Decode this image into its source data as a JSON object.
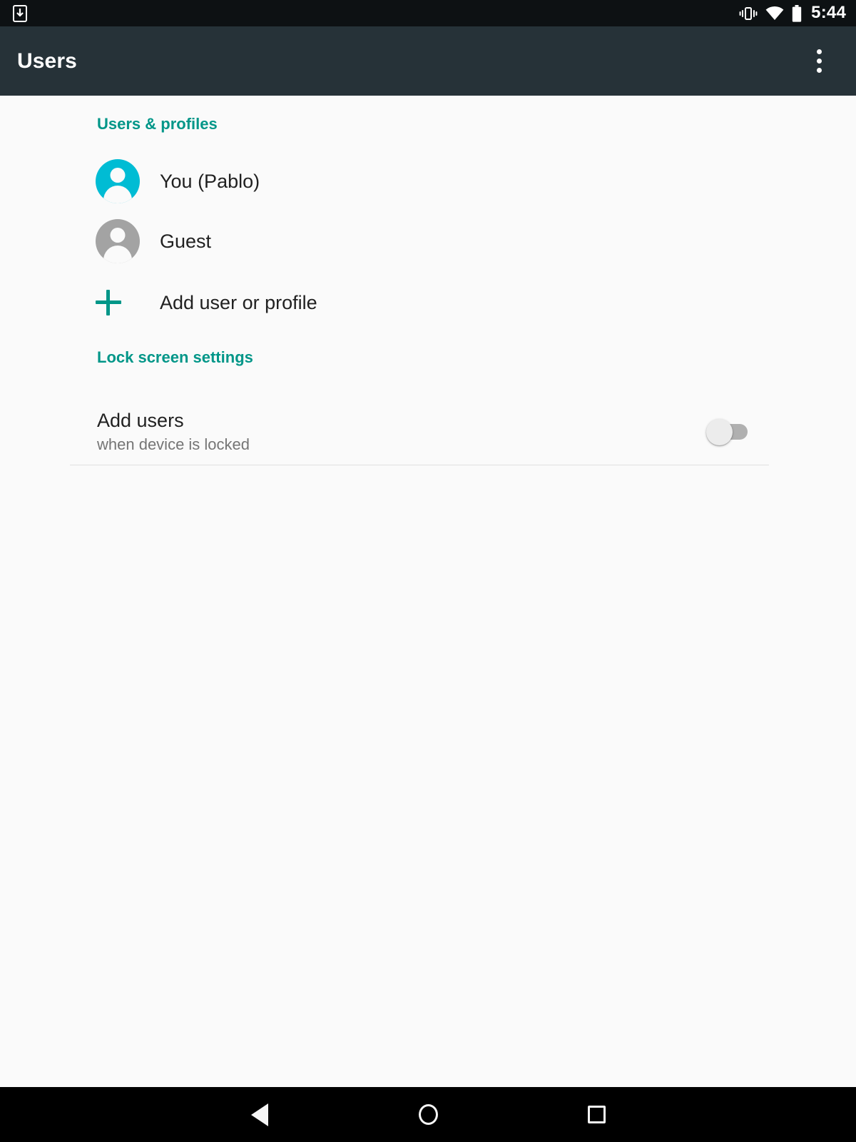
{
  "status_bar": {
    "download_icon": "download-indicator-icon",
    "vibrate_icon": "vibrate-icon",
    "wifi_icon": "wifi-icon",
    "battery_icon": "battery-full-icon",
    "clock": "5:44"
  },
  "app_bar": {
    "title": "Users",
    "overflow_icon": "more-vertical-icon",
    "background_color": "#263238"
  },
  "sections": {
    "users_profiles": {
      "header": "Users & profiles",
      "header_color": "#009688",
      "items": [
        {
          "label": "You (Pablo)",
          "avatar_color": "#00bcd4",
          "icon": "person-avatar-icon"
        },
        {
          "label": "Guest",
          "avatar_color": "#a3a3a3",
          "icon": "person-avatar-icon"
        },
        {
          "label": "Add user or profile",
          "icon": "plus-icon",
          "icon_color": "#009688"
        }
      ]
    },
    "lock_screen_settings": {
      "header": "Lock screen settings",
      "header_color": "#009688",
      "setting": {
        "title": "Add users",
        "subtitle": "when device is locked",
        "switch_state": "off"
      }
    }
  },
  "nav_bar": {
    "back": "back-icon",
    "home": "home-icon",
    "recents": "recents-icon"
  }
}
